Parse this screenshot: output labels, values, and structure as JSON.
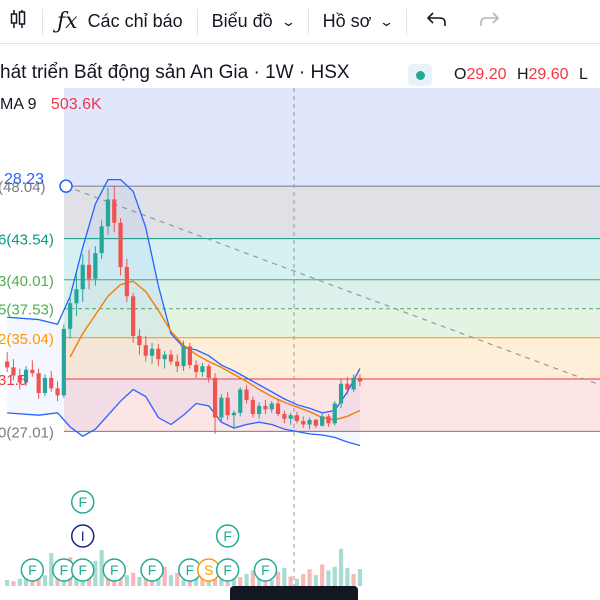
{
  "toolbar": {
    "indicators_label": "Các chỉ báo",
    "chart_label": "Biểu đồ",
    "profile_label": "Hồ sơ",
    "icons": [
      "candles-icon",
      "function-icon",
      "chevron-down-icon",
      "undo-icon",
      "redo-icon"
    ]
  },
  "legend": {
    "title": "hát triển Bất động sản An Gia · 1W · HSX",
    "open_key": "O",
    "open_value": "29.20",
    "high_key": "H",
    "high_value": "29.60",
    "extra": "L",
    "volume_ma_label": "MA 9",
    "volume_ma_value": "503.6K"
  },
  "colors": {
    "up": "#26a69a",
    "down": "#ef5350",
    "bollinger": "#2962ff",
    "ma_line": "#f57c00",
    "fib_0": "#787b86",
    "fib_0236": "#f23645",
    "fib_0382": "#ff9800",
    "fib_05": "#4caf50",
    "fib_0618": "#089981",
    "fib_0786": "#00bcd4",
    "fib_1": "#787b86",
    "accent_blue": "#2962ff"
  },
  "chart_data": {
    "type": "candlestick",
    "price_scale": {
      "min": 25.5,
      "max": 52.0
    },
    "current_price_label": "28.23",
    "fib_levels": [
      {
        "ratio": "",
        "label": "(48.04)",
        "price": 48.04,
        "color": "#787b86"
      },
      {
        "ratio": "6",
        "label": "(43.54)",
        "price": 43.54,
        "color": "#089981"
      },
      {
        "ratio": "3",
        "label": "(40.01)",
        "price": 40.01,
        "color": "#4caf50"
      },
      {
        "ratio": "5",
        "label": "(37.53)",
        "price": 37.53,
        "color": "#4caf50"
      },
      {
        "ratio": "2",
        "label": "(35.04)",
        "price": 35.04,
        "color": "#ff9800"
      },
      {
        "ratio": "",
        "label": "31.5",
        "price": 31.5,
        "color": "#f23645"
      },
      {
        "ratio": "0",
        "label": "(27.01)",
        "price": 27.01,
        "color": "#787b86"
      }
    ],
    "candles": [
      [
        33.0,
        33.8,
        32.1,
        32.5
      ],
      [
        32.5,
        33.2,
        31.4,
        31.8
      ],
      [
        31.8,
        32.4,
        30.6,
        31.2
      ],
      [
        31.2,
        32.6,
        30.9,
        32.3
      ],
      [
        32.3,
        33.1,
        31.7,
        32.0
      ],
      [
        32.0,
        32.4,
        29.8,
        30.3
      ],
      [
        30.3,
        31.9,
        30.0,
        31.6
      ],
      [
        31.6,
        32.2,
        30.4,
        30.7
      ],
      [
        30.7,
        31.3,
        29.6,
        30.1
      ],
      [
        30.1,
        36.2,
        29.9,
        35.8
      ],
      [
        35.8,
        38.5,
        35.0,
        38.0
      ],
      [
        38.0,
        40.6,
        36.9,
        39.2
      ],
      [
        39.2,
        42.2,
        38.1,
        41.3
      ],
      [
        41.3,
        42.6,
        39.2,
        40.1
      ],
      [
        40.1,
        42.9,
        39.5,
        42.3
      ],
      [
        42.3,
        45.1,
        41.8,
        44.6
      ],
      [
        44.6,
        47.9,
        43.9,
        46.9
      ],
      [
        46.9,
        48.1,
        44.1,
        44.9
      ],
      [
        44.9,
        45.3,
        40.4,
        41.1
      ],
      [
        41.1,
        41.8,
        38.1,
        38.6
      ],
      [
        38.6,
        38.9,
        34.6,
        35.2
      ],
      [
        35.2,
        35.8,
        33.6,
        34.4
      ],
      [
        34.4,
        35.2,
        33.0,
        33.5
      ],
      [
        33.5,
        34.6,
        32.8,
        34.1
      ],
      [
        34.1,
        34.5,
        32.6,
        33.2
      ],
      [
        33.2,
        33.9,
        32.4,
        33.6
      ],
      [
        33.6,
        34.0,
        32.7,
        33.0
      ],
      [
        33.0,
        33.6,
        32.1,
        32.6
      ],
      [
        32.6,
        34.8,
        32.2,
        34.3
      ],
      [
        34.3,
        34.6,
        32.4,
        32.7
      ],
      [
        32.7,
        33.1,
        31.6,
        32.1
      ],
      [
        32.1,
        32.9,
        31.7,
        32.6
      ],
      [
        32.6,
        32.8,
        31.2,
        31.6
      ],
      [
        31.6,
        32.0,
        26.8,
        28.2
      ],
      [
        28.2,
        30.2,
        27.9,
        29.9
      ],
      [
        29.9,
        30.4,
        28.0,
        28.4
      ],
      [
        28.4,
        28.8,
        27.3,
        28.6
      ],
      [
        28.6,
        30.8,
        28.3,
        30.6
      ],
      [
        30.6,
        31.0,
        29.4,
        29.7
      ],
      [
        29.7,
        30.0,
        28.2,
        28.5
      ],
      [
        28.5,
        29.5,
        28.1,
        29.2
      ],
      [
        29.2,
        29.7,
        28.5,
        28.9
      ],
      [
        28.9,
        29.6,
        28.6,
        29.4
      ],
      [
        29.4,
        29.8,
        28.3,
        28.5
      ],
      [
        28.5,
        28.8,
        27.7,
        28.1
      ],
      [
        28.1,
        28.6,
        27.6,
        28.4
      ],
      [
        28.4,
        28.7,
        27.7,
        27.9
      ],
      [
        27.9,
        28.3,
        27.3,
        27.6
      ],
      [
        27.6,
        28.2,
        27.2,
        28.0
      ],
      [
        28.0,
        28.1,
        27.3,
        27.5
      ],
      [
        27.5,
        28.6,
        27.4,
        28.3
      ],
      [
        28.3,
        28.5,
        27.4,
        27.7
      ],
      [
        27.7,
        29.6,
        27.5,
        29.4
      ],
      [
        29.4,
        31.5,
        29.0,
        31.1
      ],
      [
        31.1,
        31.7,
        30.2,
        30.6
      ],
      [
        30.6,
        31.9,
        30.4,
        31.6
      ],
      [
        31.6,
        31.9,
        30.9,
        31.3
      ]
    ],
    "bollinger_upper": [
      [
        0,
        36.8
      ],
      [
        5,
        36.6
      ],
      [
        8,
        36.2
      ],
      [
        10,
        38.6
      ],
      [
        12,
        42.8
      ],
      [
        14,
        46.5
      ],
      [
        16,
        48.6
      ],
      [
        18,
        48.6
      ],
      [
        20,
        47.6
      ],
      [
        22,
        44.5
      ],
      [
        24,
        39.5
      ],
      [
        26,
        35.4
      ],
      [
        28,
        34.2
      ],
      [
        30,
        34.0
      ],
      [
        32,
        33.5
      ],
      [
        34,
        32.7
      ],
      [
        36,
        32.2
      ],
      [
        38,
        31.6
      ],
      [
        40,
        31.0
      ],
      [
        42,
        30.4
      ],
      [
        44,
        29.8
      ],
      [
        46,
        29.3
      ],
      [
        48,
        29.0
      ],
      [
        50,
        28.6
      ],
      [
        52,
        28.8
      ],
      [
        54,
        30.4
      ],
      [
        56,
        32.4
      ]
    ],
    "bollinger_lower": [
      [
        0,
        28.6
      ],
      [
        5,
        28.4
      ],
      [
        8,
        28.6
      ],
      [
        10,
        27.4
      ],
      [
        12,
        26.6
      ],
      [
        14,
        27.2
      ],
      [
        16,
        28.4
      ],
      [
        18,
        29.6
      ],
      [
        20,
        30.6
      ],
      [
        22,
        30.0
      ],
      [
        24,
        28.2
      ],
      [
        26,
        27.6
      ],
      [
        28,
        28.4
      ],
      [
        30,
        29.4
      ],
      [
        32,
        29.2
      ],
      [
        34,
        27.8
      ],
      [
        36,
        27.3
      ],
      [
        38,
        27.6
      ],
      [
        40,
        27.8
      ],
      [
        42,
        27.6
      ],
      [
        44,
        27.2
      ],
      [
        46,
        27.0
      ],
      [
        48,
        26.8
      ],
      [
        50,
        26.7
      ],
      [
        52,
        26.5
      ],
      [
        54,
        26.1
      ],
      [
        56,
        25.8
      ]
    ],
    "ma_line": [
      [
        10,
        33.4
      ],
      [
        12,
        35.4
      ],
      [
        14,
        37.0
      ],
      [
        16,
        38.6
      ],
      [
        18,
        39.6
      ],
      [
        20,
        39.9
      ],
      [
        22,
        39.0
      ],
      [
        24,
        37.4
      ],
      [
        26,
        35.6
      ],
      [
        28,
        34.4
      ],
      [
        30,
        33.6
      ],
      [
        32,
        33.0
      ],
      [
        34,
        32.5
      ],
      [
        36,
        31.9
      ],
      [
        38,
        31.3
      ],
      [
        40,
        30.6
      ],
      [
        42,
        30.0
      ],
      [
        44,
        29.5
      ],
      [
        46,
        29.1
      ],
      [
        48,
        28.7
      ],
      [
        50,
        28.2
      ],
      [
        52,
        28.0
      ],
      [
        54,
        28.3
      ],
      [
        56,
        28.8
      ]
    ],
    "volume": [
      [
        0.1,
        1
      ],
      [
        0.08,
        0
      ],
      [
        0.12,
        1
      ],
      [
        0.4,
        1
      ],
      [
        0.15,
        0
      ],
      [
        0.28,
        0
      ],
      [
        0.18,
        1
      ],
      [
        0.55,
        1
      ],
      [
        0.32,
        0
      ],
      [
        0.22,
        1
      ],
      [
        0.48,
        0
      ],
      [
        0.3,
        1
      ],
      [
        0.2,
        1
      ],
      [
        0.35,
        0
      ],
      [
        0.42,
        1
      ],
      [
        0.6,
        1
      ],
      [
        0.38,
        0
      ],
      [
        0.25,
        0
      ],
      [
        0.3,
        0
      ],
      [
        0.18,
        1
      ],
      [
        0.22,
        0
      ],
      [
        0.15,
        1
      ],
      [
        0.4,
        0
      ],
      [
        0.28,
        0
      ],
      [
        0.12,
        1
      ],
      [
        0.32,
        0
      ],
      [
        0.18,
        1
      ],
      [
        0.22,
        0
      ],
      [
        0.1,
        1
      ],
      [
        0.3,
        0
      ],
      [
        0.16,
        1
      ],
      [
        0.2,
        0
      ],
      [
        0.14,
        1
      ],
      [
        0.4,
        0
      ],
      [
        0.22,
        1
      ],
      [
        0.18,
        0
      ],
      [
        0.12,
        1
      ],
      [
        0.15,
        0
      ],
      [
        0.2,
        1
      ],
      [
        0.26,
        0
      ],
      [
        0.14,
        1
      ],
      [
        0.18,
        0
      ],
      [
        0.1,
        1
      ],
      [
        0.24,
        0
      ],
      [
        0.3,
        1
      ],
      [
        0.16,
        0
      ],
      [
        0.12,
        1
      ],
      [
        0.2,
        0
      ],
      [
        0.28,
        0
      ],
      [
        0.18,
        1
      ],
      [
        0.36,
        0
      ],
      [
        0.26,
        1
      ],
      [
        0.32,
        1
      ],
      [
        0.62,
        1
      ],
      [
        0.3,
        1
      ],
      [
        0.2,
        0
      ],
      [
        0.28,
        1
      ]
    ],
    "event_markers": [
      {
        "candle": 4,
        "letter": "F",
        "row": 0
      },
      {
        "candle": 9,
        "letter": "F",
        "row": 0
      },
      {
        "candle": 12,
        "letter": "F",
        "row": 0
      },
      {
        "candle": 12,
        "letter": "I",
        "row": 1
      },
      {
        "candle": 12,
        "letter": "F",
        "row": 2
      },
      {
        "candle": 17,
        "letter": "F",
        "row": 0
      },
      {
        "candle": 23,
        "letter": "F",
        "row": 0
      },
      {
        "candle": 29,
        "letter": "F",
        "row": 0
      },
      {
        "candle": 32,
        "letter": "S",
        "row": 0
      },
      {
        "candle": 35,
        "letter": "F",
        "row": 0
      },
      {
        "candle": 35,
        "letter": "F",
        "row": 1
      },
      {
        "candle": 41,
        "letter": "F",
        "row": 0
      }
    ]
  }
}
